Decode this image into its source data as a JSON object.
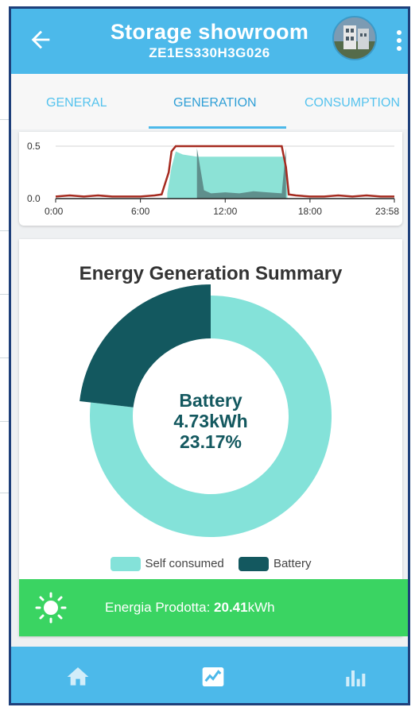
{
  "appbar": {
    "title": "Storage showroom",
    "subtitle": "ZE1ES330H3G026",
    "back_icon": "arrow-left-icon",
    "menu_icon": "more-vertical-icon"
  },
  "tabs": [
    {
      "label": "GENERAL",
      "active": false
    },
    {
      "label": "GENERATION",
      "active": true
    },
    {
      "label": "CONSUMPTION",
      "active": false
    }
  ],
  "chart_data": [
    {
      "type": "line",
      "title": "",
      "xlabel": "",
      "ylabel": "",
      "x_ticks": [
        "0:00",
        "6:00",
        "12:00",
        "18:00",
        "23:58"
      ],
      "y_ticks": [
        "0.0",
        "0.5"
      ],
      "ylim": [
        0,
        0.5
      ],
      "grid": true,
      "series": [
        {
          "type": "line",
          "color": "#a52a1f",
          "x": [
            0,
            1,
            2,
            3,
            4,
            5,
            6,
            7,
            7.5,
            8,
            8.2,
            8.5,
            9,
            10,
            11,
            12,
            13,
            14,
            15,
            16,
            16.3,
            16.5,
            17,
            18,
            19,
            20,
            21,
            22,
            23,
            23.97
          ],
          "y": [
            0.02,
            0.03,
            0.02,
            0.03,
            0.02,
            0.02,
            0.02,
            0.03,
            0.04,
            0.25,
            0.45,
            0.5,
            0.5,
            0.5,
            0.5,
            0.5,
            0.5,
            0.5,
            0.5,
            0.5,
            0.3,
            0.04,
            0.03,
            0.02,
            0.02,
            0.03,
            0.02,
            0.03,
            0.02,
            0.02
          ]
        },
        {
          "type": "area",
          "color": "#8ce2d6",
          "x": [
            7.9,
            8.2,
            8.5,
            9,
            10,
            16.2,
            16.4
          ],
          "y": [
            0.05,
            0.3,
            0.45,
            0.42,
            0.4,
            0.4,
            0.05
          ]
        },
        {
          "type": "area",
          "color": "#5f8f8c",
          "x": [
            10,
            10.5,
            11,
            12,
            13,
            14,
            15,
            16,
            16.3
          ],
          "y": [
            0.48,
            0.08,
            0.05,
            0.06,
            0.05,
            0.07,
            0.06,
            0.05,
            0.48
          ]
        }
      ]
    },
    {
      "type": "pie",
      "title": "Energy Generation Summary",
      "labels": [
        "Self consumed",
        "Battery"
      ],
      "values": [
        76.83,
        23.17
      ],
      "colors": [
        "#84e2d9",
        "#13585f"
      ],
      "legend": "bottom",
      "center_label": {
        "name": "Battery",
        "value": "4.73kWh",
        "percent": "23.17%"
      }
    }
  ],
  "production": {
    "label": "Energia Prodotta: ",
    "value": "20.41",
    "unit": "kWh",
    "icon": "sun-icon"
  },
  "bottomnav": [
    {
      "icon": "home-icon"
    },
    {
      "icon": "chart-line-icon",
      "active": true
    },
    {
      "icon": "bar-chart-icon"
    }
  ]
}
